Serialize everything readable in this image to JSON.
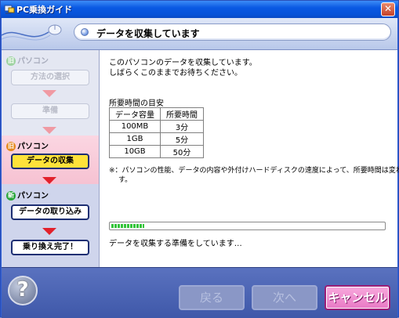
{
  "window": {
    "title": "PC乗換ガイド",
    "close_glyph": "✕"
  },
  "header": {
    "text": "データを収集しています"
  },
  "sidebar": {
    "section_old": {
      "label": "パソコン",
      "badge": "旧"
    },
    "section_new": {
      "label": "パソコン",
      "badge": "新"
    },
    "steps": [
      "方法の選択",
      "準備",
      "データの収集",
      "データの取り込み",
      "乗り換え完了！"
    ]
  },
  "main": {
    "line1": "このパソコンのデータを収集しています。",
    "line2": "しばらくこのままでお待ちください。",
    "table_title": "所要時間の目安",
    "table_headers": [
      "データ容量",
      "所要時間"
    ],
    "table_rows": [
      [
        "100MB",
        "3分"
      ],
      [
        "1GB",
        "5分"
      ],
      [
        "10GB",
        "50分"
      ]
    ],
    "note_line1": "※：パソコンの性能、データの内容や外付けハードディスクの速度によって、所要時間は変わりま",
    "note_line2": "す。",
    "progress_fraction": 0.12,
    "status": "データを収集する準備をしています…"
  },
  "footer": {
    "help_glyph": "?",
    "back": "戻る",
    "next": "次へ",
    "cancel": "キャンセル"
  },
  "colors": {
    "active_step": "#ffe23a",
    "arrow": "#e2212b",
    "cancel": "#e87ac5",
    "progress": "#34c53a"
  }
}
